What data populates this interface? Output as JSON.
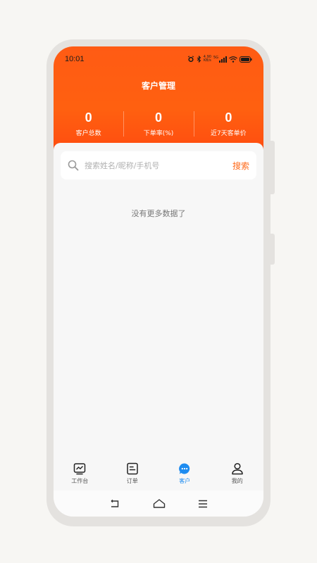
{
  "status_bar": {
    "time": "10:01",
    "net_speed_value": "4.90",
    "net_speed_unit": "KB/s",
    "signal_label": "5G"
  },
  "header": {
    "title": "客户管理"
  },
  "stats": [
    {
      "value": "0",
      "label": "客户总数"
    },
    {
      "value": "0",
      "label": "下单率(%)"
    },
    {
      "value": "0",
      "label": "近7天客单价"
    }
  ],
  "search": {
    "placeholder": "搜索姓名/昵称/手机号",
    "value": "",
    "button_label": "搜索"
  },
  "empty_state": {
    "text": "没有更多数据了"
  },
  "tabbar": {
    "items": [
      {
        "label": "工作台",
        "icon": "dashboard-icon",
        "active": false
      },
      {
        "label": "订单",
        "icon": "order-icon",
        "active": false
      },
      {
        "label": "客户",
        "icon": "customer-chat-icon",
        "active": true
      },
      {
        "label": "我的",
        "icon": "profile-icon",
        "active": false
      }
    ]
  },
  "colors": {
    "accent": "#ff6010",
    "active_tab": "#1e8cf0"
  }
}
